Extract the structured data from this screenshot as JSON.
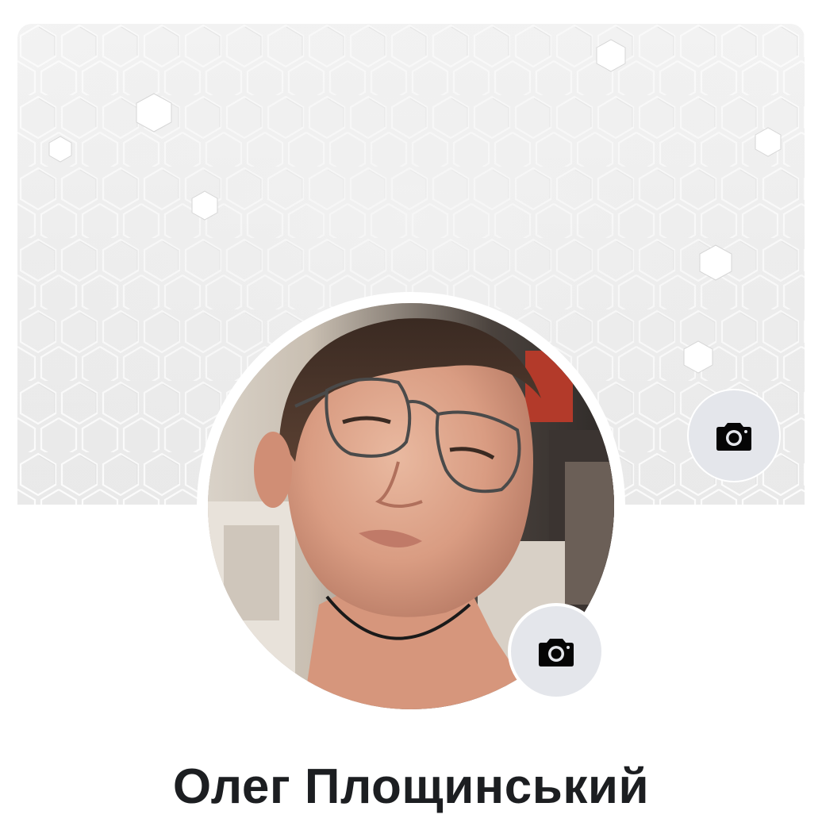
{
  "profile": {
    "name": "Олег Площинський"
  },
  "icons": {
    "cover_camera": "camera-icon",
    "avatar_camera": "camera-icon"
  },
  "colors": {
    "camera_button_bg": "#e4e6eb",
    "name_text": "#1c1e21",
    "background": "#ffffff"
  }
}
